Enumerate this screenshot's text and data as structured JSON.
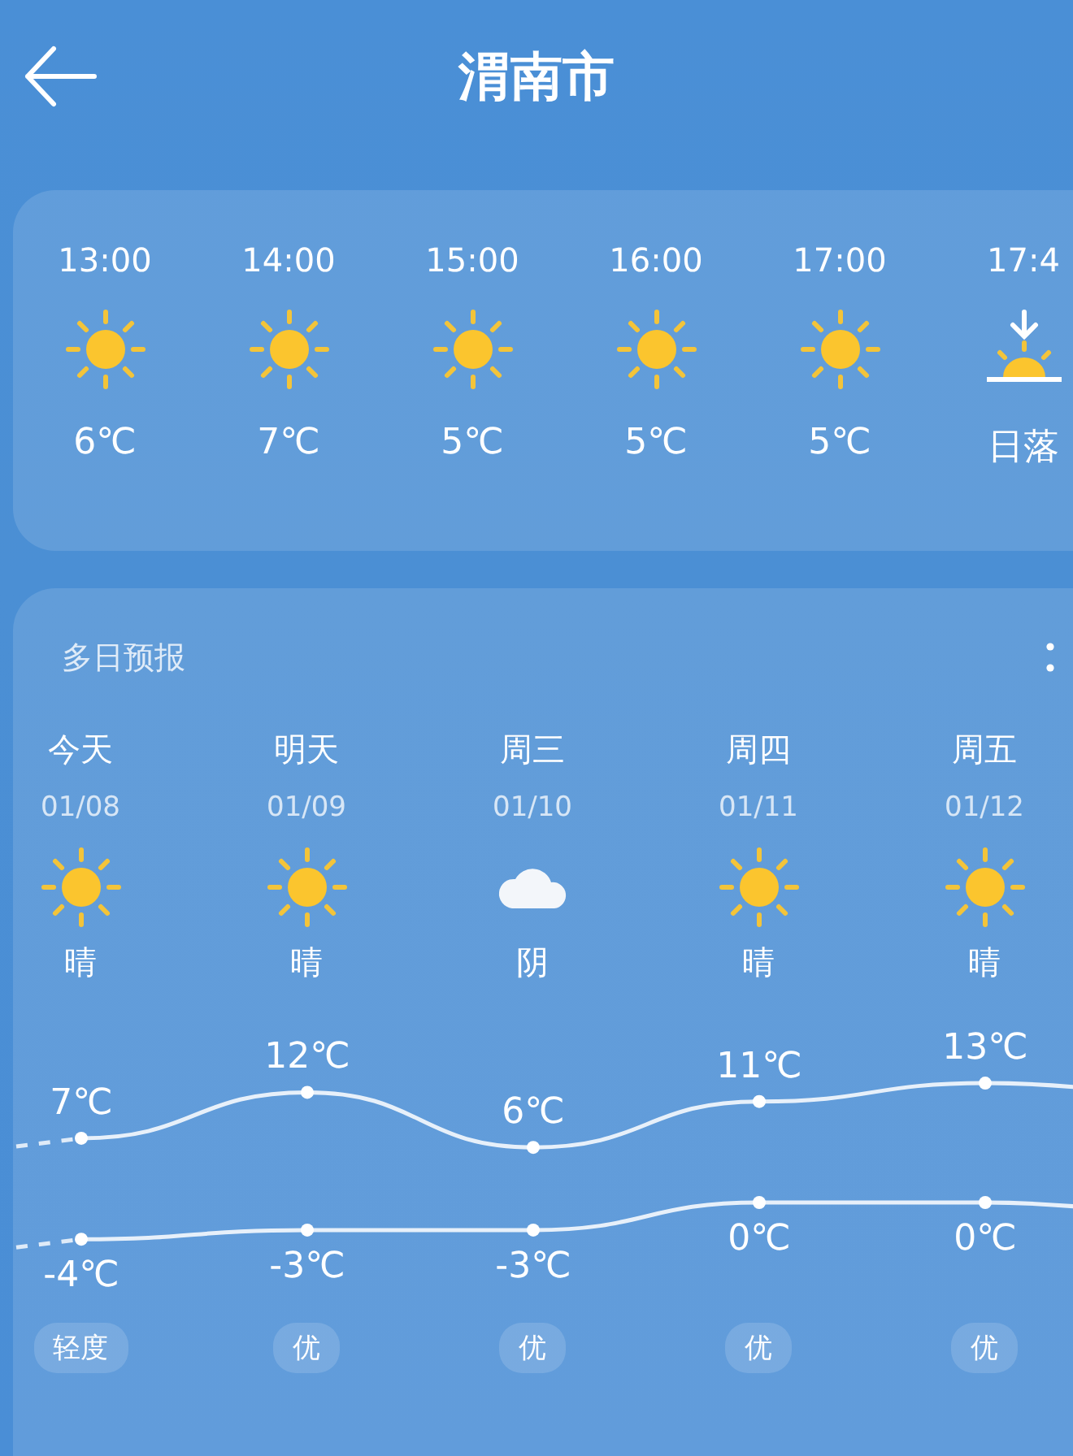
{
  "header": {
    "title": "渭南市"
  },
  "hourly": [
    {
      "time": "13:00",
      "kind": "sun",
      "value": "6℃"
    },
    {
      "time": "14:00",
      "kind": "sun",
      "value": "7℃"
    },
    {
      "time": "15:00",
      "kind": "sun",
      "value": "5℃"
    },
    {
      "time": "16:00",
      "kind": "sun",
      "value": "5℃"
    },
    {
      "time": "17:00",
      "kind": "sun",
      "value": "5℃"
    },
    {
      "time": "17:4",
      "kind": "sunset",
      "value": "日落"
    }
  ],
  "forecast": {
    "title": "多日预报",
    "days": [
      {
        "day": "今天",
        "kind": "sun",
        "condition": "晴",
        "aqi": "轻度"
      },
      {
        "day": "明天",
        "kind": "sun",
        "condition": "晴",
        "aqi": "优"
      },
      {
        "day": "周三",
        "kind": "cloud",
        "condition": "阴",
        "aqi": "优"
      },
      {
        "day": "周四",
        "kind": "sun",
        "condition": "晴",
        "aqi": "优"
      },
      {
        "day": "周五",
        "kind": "sun",
        "condition": "晴",
        "aqi": "优"
      }
    ],
    "chart_data": {
      "type": "line",
      "categories": [
        "01/08",
        "01/09",
        "01/10",
        "01/11",
        "01/12"
      ],
      "series": [
        {
          "color": "#ffffff",
          "marker": true,
          "values": [
            7,
            12,
            6,
            11,
            13
          ],
          "value_labels": [
            "7℃",
            "12℃",
            "6℃",
            "11℃",
            "13℃"
          ]
        },
        {
          "color": "#ffffff",
          "marker": true,
          "values": [
            -4,
            -3,
            -3,
            0,
            0
          ],
          "value_labels": [
            "-4℃",
            "-3℃",
            "-3℃",
            "0℃",
            "0℃"
          ]
        }
      ]
    }
  }
}
